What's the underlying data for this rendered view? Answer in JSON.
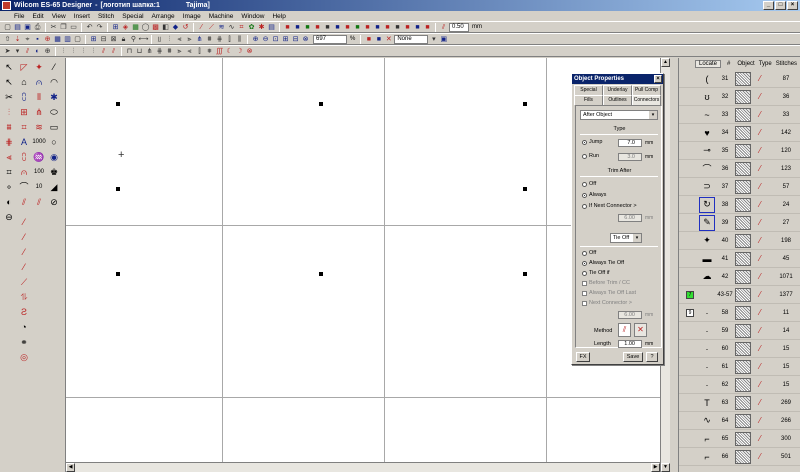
{
  "window": {
    "app_name": "Wilcom ES-65 Designer",
    "separator": "-",
    "document": "[логотип шапка:1",
    "machine": "Tajima]",
    "min": "_",
    "max": "□",
    "close": "×"
  },
  "menu": [
    "File",
    "Edit",
    "View",
    "Insert",
    "Stitch",
    "Special",
    "Arrange",
    "Image",
    "Machine",
    "Window",
    "Help"
  ],
  "toolbar": {
    "spacing_value": "0.50",
    "spacing_unit": "mm",
    "zoom_value": "697",
    "zoom_unit": "%",
    "none_label": "None"
  },
  "dialog": {
    "title": "Object Properties",
    "close": "×",
    "tabs_top": [
      "Special",
      "Underlay",
      "Pull Comp"
    ],
    "tabs_bottom": [
      "Fills",
      "Outlines",
      "Connectors"
    ],
    "select_connector": "After Object",
    "type_label": "Type",
    "jump_label": "Jump",
    "jump_value": "7.0",
    "run_label": "Run",
    "run_value": "3.0",
    "mm": "mm",
    "trim_after_label": "Trim After",
    "trim_off": "Off",
    "trim_always": "Always",
    "trim_if_next": "If Next Connector >",
    "trim_value": "6.00",
    "tie_off_select": "Tie Off",
    "tie_off": "Off",
    "tie_always": "Always Tie Off",
    "tie_if": "Tie Off if",
    "tie_before_trim": "Before Trim / CC",
    "tie_always_before": "Always Tie Off Last",
    "tie_next_connector": "Next Connector >",
    "tie_value": "6.00",
    "method_label": "Method",
    "length_label": "Length",
    "length_value": "1.00",
    "fx_button": "FX",
    "save_button": "Save",
    "help_button": "?"
  },
  "sequence": {
    "headers": {
      "locate": "Locate",
      "num": "#",
      "object": "Object",
      "type": "Type",
      "stitches": "Stitches"
    },
    "rows": [
      {
        "num": "31",
        "stitches": "87",
        "thumb": "(",
        "selected": false
      },
      {
        "num": "32",
        "stitches": "36",
        "thumb": "ʊ",
        "selected": false
      },
      {
        "num": "33",
        "stitches": "33",
        "thumb": "~",
        "selected": false
      },
      {
        "num": "34",
        "stitches": "142",
        "thumb": "♥",
        "selected": false
      },
      {
        "num": "35",
        "stitches": "120",
        "thumb": "⊸",
        "selected": false
      },
      {
        "num": "36",
        "stitches": "123",
        "thumb": "⌒",
        "selected": false
      },
      {
        "num": "37",
        "stitches": "57",
        "thumb": "⊃",
        "selected": false
      },
      {
        "num": "38",
        "stitches": "24",
        "thumb": "↻",
        "selected": true
      },
      {
        "num": "39",
        "stitches": "27",
        "thumb": "✎",
        "selected": true
      },
      {
        "num": "40",
        "stitches": "198",
        "thumb": "✦",
        "selected": false
      },
      {
        "num": "41",
        "stitches": "45",
        "thumb": "▬",
        "selected": false
      },
      {
        "num": "42",
        "stitches": "1071",
        "thumb": "☁",
        "selected": false
      },
      {
        "num": "43-57",
        "stitches": "1377",
        "thumb": "",
        "selected": false,
        "color": "#33dd33",
        "color_num": "7"
      },
      {
        "num": "58",
        "stitches": "11",
        "thumb": "·",
        "selected": false,
        "color": "#ffffff",
        "color_num": "9"
      },
      {
        "num": "59",
        "stitches": "14",
        "thumb": "·",
        "selected": false
      },
      {
        "num": "60",
        "stitches": "15",
        "thumb": "·",
        "selected": false
      },
      {
        "num": "61",
        "stitches": "15",
        "thumb": "·",
        "selected": false
      },
      {
        "num": "62",
        "stitches": "15",
        "thumb": "·",
        "selected": false
      },
      {
        "num": "63",
        "stitches": "269",
        "thumb": "T",
        "selected": false
      },
      {
        "num": "64",
        "stitches": "266",
        "thumb": "∿",
        "selected": false
      },
      {
        "num": "65",
        "stitches": "300",
        "thumb": "⌐",
        "selected": false
      },
      {
        "num": "66",
        "stitches": "501",
        "thumb": "⌐",
        "selected": false
      }
    ]
  }
}
